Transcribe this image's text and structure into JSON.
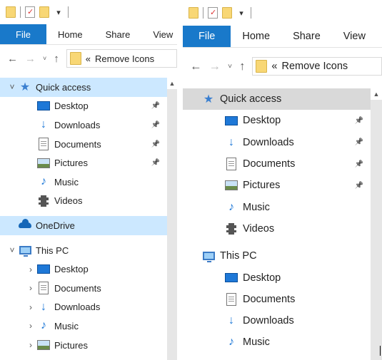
{
  "panes": [
    {
      "id": "left",
      "ribbon_tabs": [
        "File",
        "Home",
        "Share",
        "View"
      ],
      "address": {
        "chevrons": "«",
        "path": "Remove Icons"
      },
      "tree": [
        {
          "label": "Quick access",
          "icon": "star-icon",
          "chevron": "˅",
          "level": 1,
          "selected": true,
          "pinned": false
        },
        {
          "label": "Desktop",
          "icon": "desktop-icon",
          "level": 2,
          "pinned": true
        },
        {
          "label": "Downloads",
          "icon": "downloads-icon",
          "level": 2,
          "pinned": true
        },
        {
          "label": "Documents",
          "icon": "documents-icon",
          "level": 2,
          "pinned": true
        },
        {
          "label": "Pictures",
          "icon": "pictures-icon",
          "level": 2,
          "pinned": true
        },
        {
          "label": "Music",
          "icon": "music-icon",
          "level": 2,
          "pinned": false
        },
        {
          "label": "Videos",
          "icon": "videos-icon",
          "level": 2,
          "pinned": false
        },
        {
          "label": "OneDrive",
          "icon": "onedrive-icon",
          "level": 1,
          "selected": true,
          "gap": true
        },
        {
          "label": "This PC",
          "icon": "this-pc-icon",
          "chevron": "˅",
          "level": 1,
          "gap": true
        },
        {
          "label": "Desktop",
          "icon": "desktop-icon",
          "chevron": "›",
          "level": 2
        },
        {
          "label": "Documents",
          "icon": "documents-icon",
          "chevron": "›",
          "level": 2
        },
        {
          "label": "Downloads",
          "icon": "downloads-icon",
          "chevron": "›",
          "level": 2
        },
        {
          "label": "Music",
          "icon": "music-icon",
          "chevron": "›",
          "level": 2
        },
        {
          "label": "Pictures",
          "icon": "pictures-icon",
          "chevron": "›",
          "level": 2
        }
      ]
    },
    {
      "id": "right",
      "ribbon_tabs": [
        "File",
        "Home",
        "Share",
        "View"
      ],
      "address": {
        "chevrons": "«",
        "path": "Remove Icons"
      },
      "tree": [
        {
          "label": "Quick access",
          "icon": "star-icon",
          "level": 1,
          "selected": true
        },
        {
          "label": "Desktop",
          "icon": "desktop-icon",
          "level": 2,
          "pinned": true
        },
        {
          "label": "Downloads",
          "icon": "downloads-icon",
          "level": 2,
          "pinned": true
        },
        {
          "label": "Documents",
          "icon": "documents-icon",
          "level": 2,
          "pinned": true
        },
        {
          "label": "Pictures",
          "icon": "pictures-icon",
          "level": 2,
          "pinned": true
        },
        {
          "label": "Music",
          "icon": "music-icon",
          "level": 2
        },
        {
          "label": "Videos",
          "icon": "videos-icon",
          "level": 2
        },
        {
          "label": "This PC",
          "icon": "this-pc-icon",
          "level": 1,
          "gap": true
        },
        {
          "label": "Desktop",
          "icon": "desktop-icon",
          "level": 2
        },
        {
          "label": "Documents",
          "icon": "documents-icon",
          "level": 2
        },
        {
          "label": "Downloads",
          "icon": "downloads-icon",
          "level": 2
        },
        {
          "label": "Music",
          "icon": "music-icon",
          "level": 2
        }
      ]
    }
  ],
  "colors": {
    "file_tab": "#1979ca",
    "selected_left": "#cce8ff",
    "selected_right": "#d9d9d9",
    "accent_icon": "#1e78d7"
  }
}
